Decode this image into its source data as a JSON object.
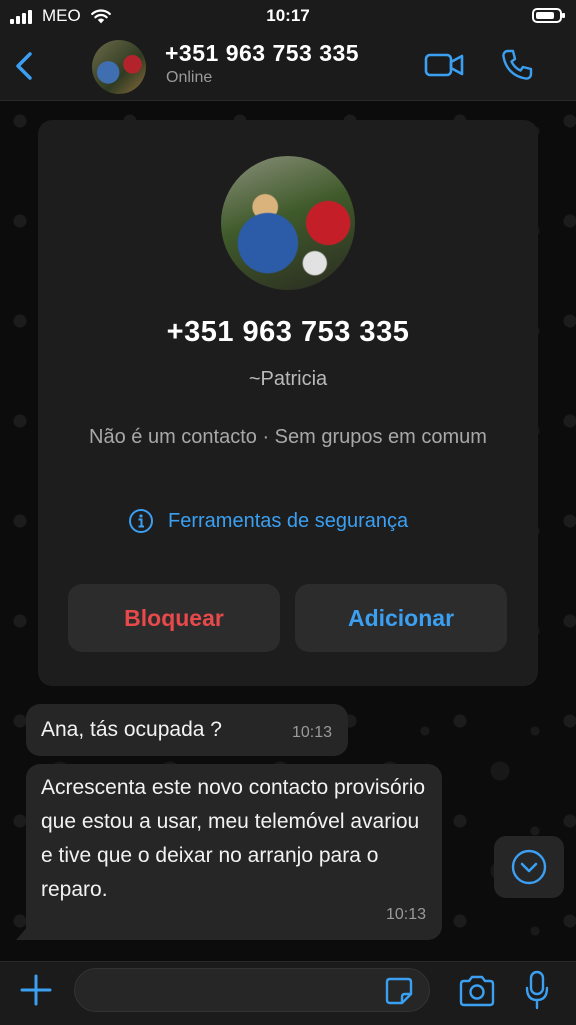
{
  "status_bar": {
    "carrier": "MEO",
    "time": "10:17"
  },
  "header": {
    "title": "+351 963 753 335",
    "subtitle": "Online"
  },
  "contact_card": {
    "phone": "+351 963 753 335",
    "name": "~Patricia",
    "description": "Não é um contacto · Sem grupos em comum",
    "safety_tools": "Ferramentas de segurança",
    "block_label": "Bloquear",
    "add_label": "Adicionar"
  },
  "messages": [
    {
      "text": "Ana, tás ocupada ?",
      "time": "10:13"
    },
    {
      "text": "Acrescenta este novo contacto provisório que estou a usar, meu telemóvel avariou e tive que o deixar no arranjo para o reparo.",
      "time": "10:13"
    }
  ],
  "input": {
    "value": "",
    "placeholder": ""
  },
  "colors": {
    "accent": "#3b9ff2",
    "danger": "#e8494b",
    "bubble": "#262626",
    "card": "#1d1d1d"
  },
  "icons": [
    "signal-icon",
    "wifi-icon",
    "battery-icon",
    "back-icon",
    "video-call-icon",
    "phone-call-icon",
    "info-icon",
    "chevron-down-icon",
    "plus-icon",
    "sticker-icon",
    "camera-icon",
    "microphone-icon"
  ]
}
